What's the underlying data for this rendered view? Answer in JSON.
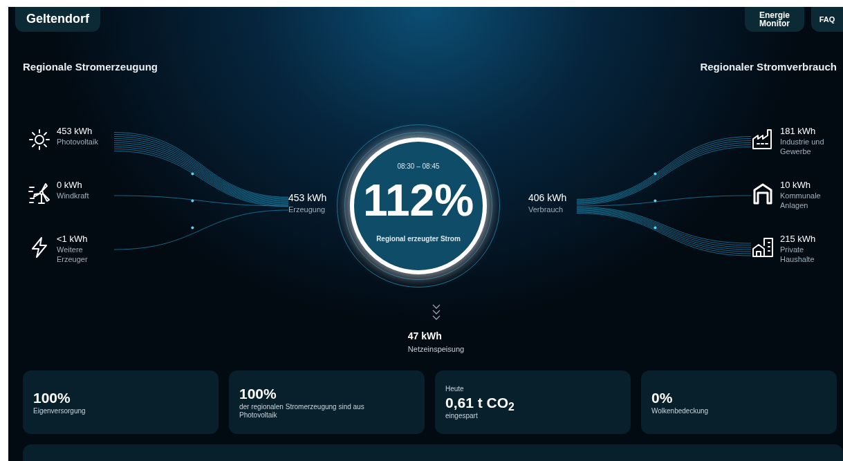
{
  "header": {
    "location": "Geltendorf",
    "nav": [
      {
        "label": "Energie Monitor"
      },
      {
        "label": "FAQ"
      }
    ]
  },
  "generation": {
    "title": "Regionale Stromerzeugung",
    "sources": [
      {
        "kind": "solar",
        "value": "453 kWh",
        "label": "Photovoltaik"
      },
      {
        "kind": "wind",
        "value": "0 kWh",
        "label": "Windkraft"
      },
      {
        "kind": "other",
        "value": "<1 kWh",
        "label": "Weitere Erzeuger"
      }
    ],
    "total": {
      "value": "453 kWh",
      "label": "Erzeugung"
    }
  },
  "center": {
    "period": "08:30 – 08:45",
    "percent": "112%",
    "label": "Regional erzeugter Strom"
  },
  "consumption": {
    "title": "Regionaler Stromverbrauch",
    "total": {
      "value": "406 kWh",
      "label": "Verbrauch"
    },
    "sinks": [
      {
        "kind": "industry",
        "value": "181 kWh",
        "label": "Industrie und Gewerbe"
      },
      {
        "kind": "municipal",
        "value": "10 kWh",
        "label": "Kommunale Anlagen"
      },
      {
        "kind": "household",
        "value": "215 kWh",
        "label": "Private Haushalte"
      }
    ]
  },
  "feed_in": {
    "value": "47 kWh",
    "label": "Netzeinspeisung"
  },
  "stats": [
    {
      "value": "100%",
      "label": "Eigenversorgung"
    },
    {
      "value": "100%",
      "label": "der regionalen Stromerzeugung sind aus Photovoltaik"
    },
    {
      "caption": "Heute",
      "value": "0,61 t CO$_{2}$",
      "label": "eingespart"
    },
    {
      "value": "0%",
      "label": "Wolkenbedeckung"
    }
  ]
}
